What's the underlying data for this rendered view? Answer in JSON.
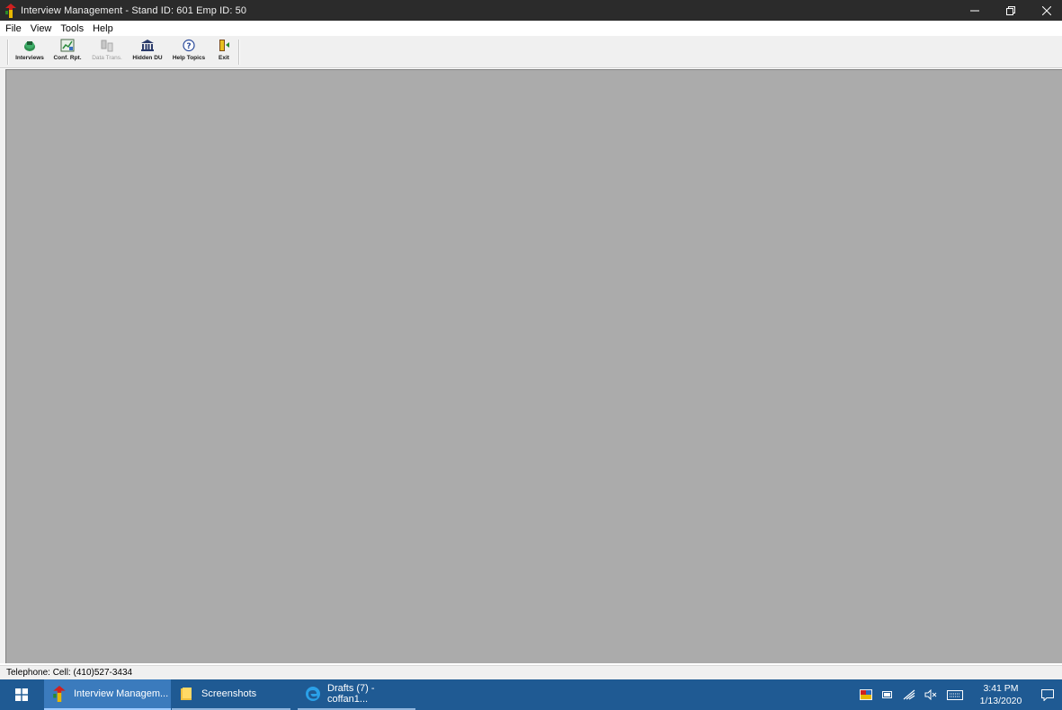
{
  "window": {
    "title": "Interview Management - Stand ID: 601  Emp ID: 50",
    "controls": [
      "minimize-icon",
      "restore-icon",
      "close-icon"
    ]
  },
  "menu": {
    "items": [
      "File",
      "View",
      "Tools",
      "Help"
    ]
  },
  "toolbar": {
    "buttons": [
      {
        "label": "Interviews",
        "icon": "interviews-icon",
        "enabled": true
      },
      {
        "label": "Conf. Rpt.",
        "icon": "report-icon",
        "enabled": true
      },
      {
        "label": "Data Trans.",
        "icon": "data-transfer-icon",
        "enabled": false
      },
      {
        "label": "Hidden DU",
        "icon": "building-icon",
        "enabled": true
      },
      {
        "label": "Help Topics",
        "icon": "help-icon",
        "enabled": true
      },
      {
        "label": "Exit",
        "icon": "exit-door-icon",
        "enabled": true
      }
    ]
  },
  "status": {
    "text": "Telephone: Cell: (410)527-3434"
  },
  "taskbar": {
    "tasks": [
      {
        "label": "Interview Managem...",
        "icon": "app-icon",
        "state": "active"
      },
      {
        "label": "Screenshots",
        "icon": "folder-icon",
        "state": "open"
      },
      {
        "label": "Drafts (7) - coffan1...",
        "icon": "edge-icon",
        "state": "open"
      }
    ],
    "clock": {
      "time": "3:41 PM",
      "date": "1/13/2020"
    }
  },
  "colors": {
    "titlebar": "#2b2b2b",
    "client_bg": "#ababab",
    "taskbar": "#1f5a93",
    "taskbar_active": "#3b7bbd"
  }
}
